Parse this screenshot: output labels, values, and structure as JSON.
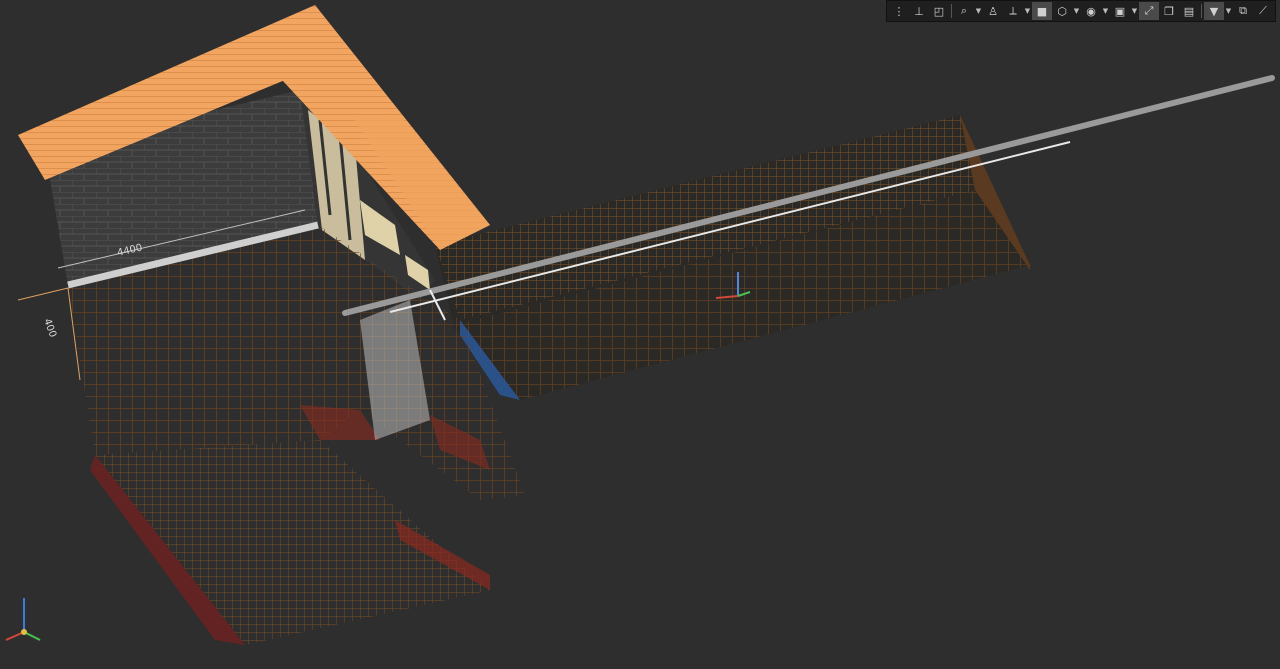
{
  "toolbar": {
    "buttons": [
      {
        "name": "grip-icon",
        "glyph": "⋮",
        "active": false
      },
      {
        "name": "dimension-tool-icon",
        "glyph": "⊥",
        "active": false
      },
      {
        "name": "section-box-icon",
        "glyph": "◰",
        "active": false
      },
      {
        "name": "sep",
        "glyph": "",
        "active": false
      },
      {
        "name": "zoom-icon",
        "glyph": "⌕",
        "active": false
      },
      {
        "name": "zoom-dropdown",
        "glyph": "▼",
        "active": false,
        "drop": true
      },
      {
        "name": "walk-icon",
        "glyph": "♙",
        "active": false
      },
      {
        "name": "axes-icon",
        "glyph": "⟂",
        "active": false
      },
      {
        "name": "axes-dropdown",
        "glyph": "▼",
        "active": false,
        "drop": true
      },
      {
        "name": "solid-cube-icon",
        "glyph": "■",
        "active": true
      },
      {
        "name": "wire-cube-icon",
        "glyph": "⬡",
        "active": false
      },
      {
        "name": "cube-dropdown",
        "glyph": "▼",
        "active": false,
        "drop": true
      },
      {
        "name": "visibility-icon",
        "glyph": "◉",
        "active": false
      },
      {
        "name": "visibility-dropdown",
        "glyph": "▼",
        "active": false,
        "drop": true
      },
      {
        "name": "camera-icon",
        "glyph": "▣",
        "active": false
      },
      {
        "name": "camera-dropdown",
        "glyph": "▼",
        "active": false,
        "drop": true
      },
      {
        "name": "snap-icon",
        "glyph": "⤢",
        "active": true
      },
      {
        "name": "layers-icon",
        "glyph": "❐",
        "active": false
      },
      {
        "name": "document-icon",
        "glyph": "▤",
        "active": false
      },
      {
        "name": "sep",
        "glyph": "",
        "active": false
      },
      {
        "name": "filter-icon",
        "glyph": "▼",
        "active": true
      },
      {
        "name": "filter-dropdown",
        "glyph": "▼",
        "active": false,
        "drop": true
      },
      {
        "name": "export-icon",
        "glyph": "⧉",
        "active": false
      },
      {
        "name": "measure-icon",
        "glyph": "⟋",
        "active": false
      }
    ]
  },
  "dimensions": {
    "width_label": "4400",
    "depth_label": "400"
  },
  "colors": {
    "background": "#2e2e2e",
    "roof": "#f0a45c",
    "brick": "#3a3a3a",
    "rebar": "#7a4a20",
    "pipe": "#9a9a9a"
  }
}
